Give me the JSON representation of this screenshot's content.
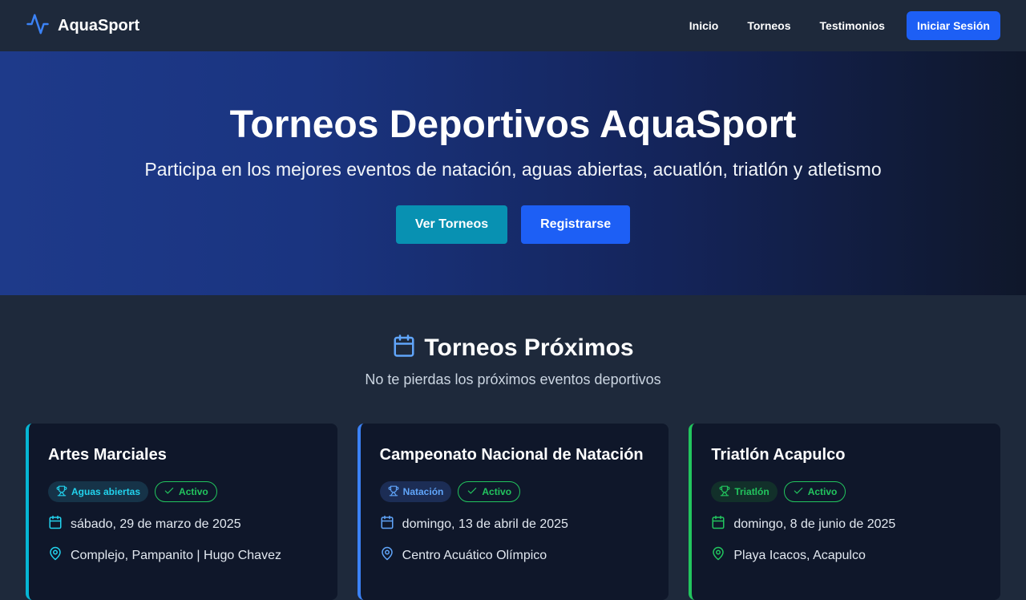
{
  "nav": {
    "brand": "AquaSport",
    "links": [
      "Inicio",
      "Torneos",
      "Testimonios"
    ],
    "login_label": "Iniciar Sesión"
  },
  "hero": {
    "title": "Torneos Deportivos AquaSport",
    "subtitle": "Participa en los mejores eventos de natación, aguas abiertas, acuatlón, triatlón y atletismo",
    "primary_button": "Ver Torneos",
    "secondary_button": "Registrarse"
  },
  "section": {
    "title": "Torneos Próximos",
    "subtitle": "No te pierdas los próximos eventos deportivos"
  },
  "tournaments": [
    {
      "title": "Artes Marciales",
      "category": "Aguas abiertas",
      "status": "Activo",
      "date": "sábado, 29 de marzo de 2025",
      "location": "Complejo, Pampanito | Hugo Chavez",
      "accent": "#06b6d4"
    },
    {
      "title": "Campeonato Nacional de Natación",
      "category": "Natación",
      "status": "Activo",
      "date": "domingo, 13 de abril de 2025",
      "location": "Centro Acuático Olímpico",
      "accent": "#3b82f6"
    },
    {
      "title": "Triatlón Acapulco",
      "category": "Triatlón",
      "status": "Activo",
      "date": "domingo, 8 de junio de 2025",
      "location": "Playa Icacos, Acapulco",
      "accent": "#22c55e"
    }
  ],
  "colors": {
    "navbar_bg": "#1e293b",
    "primary_blue": "#1d5ff5",
    "cyan_button": "#0891b2",
    "card_bg": "#0f172a",
    "active_green": "#22c55e"
  },
  "icons": {
    "brand": "activity-pulse-icon",
    "section": "calendar-icon",
    "category": "trophy-icon",
    "status": "check-icon",
    "date": "calendar-icon",
    "location": "map-pin-icon"
  }
}
